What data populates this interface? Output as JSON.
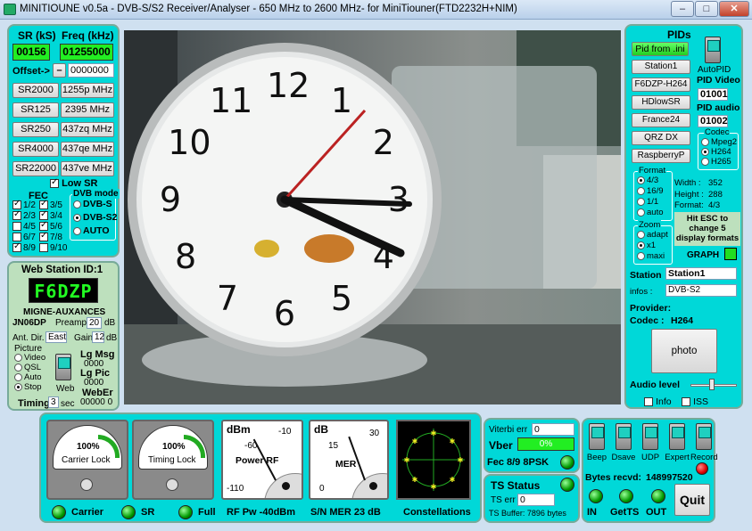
{
  "window": {
    "title": "MINITIOUNE v0.5a - DVB-S/S2 Receiver/Analyser - 650 MHz to 2600 MHz- for MiniTiouner(FTD2232H+NIM)",
    "min": "–",
    "max": "□",
    "close": "✕"
  },
  "left": {
    "sr_label": "SR (kS)",
    "freq_label": "Freq (kHz)",
    "sr_value": "00156",
    "freq_value": "01255000",
    "offset_label": "Offset->",
    "offset_sign": "–",
    "offset_value": "0000000",
    "sr_buttons": [
      "SR2000",
      "SR125",
      "SR250",
      "SR4000",
      "SR22000"
    ],
    "freq_buttons": [
      "1255p MHz",
      "2395 MHz",
      "437zq MHz",
      "437qe MHz",
      "437ve MHz"
    ],
    "low_sr": "Low SR",
    "fec_title": "FEC",
    "fec": [
      "1/2",
      "2/3",
      "4/5",
      "6/7",
      "8/9",
      "3/5",
      "3/4",
      "5/6",
      "7/8",
      "9/10"
    ],
    "dvb_title": "DVB mode",
    "dvb": [
      "DVB-S",
      "DVB-S2",
      "AUTO"
    ]
  },
  "station": {
    "title": "Web Station ID:1",
    "callsign": "F6DZP",
    "name": "MIGNE-AUXANCES",
    "locator": "JN06DP",
    "preamp_label": "Preamp",
    "preamp_value": "20",
    "preamp_unit": "dB",
    "antdir_label": "Ant. Dir.",
    "antdir_value": "East",
    "gain_label": "Gain",
    "gain_value": "12",
    "gain_unit": "dB",
    "picture_label": "Picture",
    "picture_opts": [
      "Video",
      "QSL",
      "Auto",
      "Stop"
    ],
    "lgmsg_label": "Lg Msg",
    "lgmsg_value": "0000",
    "lgpic_label": "Lg Pic",
    "lgpic_value": "0000",
    "web_label": "Web",
    "weber_label": "WebEr",
    "weber_value": "00000 0",
    "timing_label": "Timing",
    "timing_value": "3",
    "timing_unit": "sec"
  },
  "right": {
    "pids_title": "PIDs",
    "pid_from_ini": "Pid from .ini",
    "stations": [
      "Station1",
      "F6DZP-H264",
      "HDlowSR",
      "France24",
      "QRZ DX",
      "RaspberryP"
    ],
    "autopid": "AutoPID",
    "pid_video_label": "PID Video",
    "pid_video": "01001",
    "pid_audio_label": "PID audio",
    "pid_audio": "01002",
    "codec_title": "Codec",
    "codecs": [
      "Mpeg2",
      "H264",
      "H265"
    ],
    "format_title": "Format",
    "formats": [
      "4/3",
      "16/9",
      "1/1",
      "auto"
    ],
    "width_label": "Width :",
    "width_value": "352",
    "height_label": "Height :",
    "height_value": "288",
    "format_label": "Format:",
    "format_value": "4/3",
    "esc_text": "Hit ESC to change 5 display formats",
    "zoom_title": "Zoom",
    "zooms": [
      "adapt",
      "x1",
      "maxi"
    ],
    "graph": "GRAPH",
    "station_label": "Station",
    "station_value": "Station1",
    "infos_label": "infos :",
    "infos_value": "DVB-S2",
    "provider_label": "Provider:",
    "codec_label": "Codec :",
    "codec_value": "H264",
    "photo": "photo",
    "audio_label": "Audio level",
    "info_label": "Info",
    "iss_label": "ISS"
  },
  "video": {
    "clock_numbers": [
      "12",
      "1",
      "2",
      "3",
      "4",
      "5",
      "6",
      "7",
      "8",
      "9",
      "10",
      "11"
    ]
  },
  "bottom": {
    "carrier_pct": "100%",
    "carrier_label": "Carrier Lock",
    "timing_pct": "100%",
    "timing_label": "Timing Lock",
    "power_unit": "dBm",
    "power_ticks": [
      "-60",
      "-10",
      "-110"
    ],
    "power_title": "Power RF",
    "mer_unit": "dB",
    "mer_ticks": [
      "15",
      "30",
      "0"
    ],
    "mer_title": "MER",
    "viterbi_label": "Viterbi err",
    "viterbi_value": "0",
    "vber_label": "Vber",
    "vber_value": "0%",
    "fec_status": "Fec 8/9 8PSK",
    "ts_status": "TS Status",
    "ts_err_label": "TS err",
    "ts_err_value": "0",
    "ts_buffer": "TS Buffer: 7896 bytes",
    "switches": [
      "Beep",
      "Dsave",
      "UDP",
      "Expert",
      "Record"
    ],
    "bytes_label": "Bytes recvd:",
    "bytes_value": "148997520",
    "quit": "Quit",
    "in_label": "IN",
    "getts_label": "GetTS",
    "out_label": "OUT",
    "status_carrier": "Carrier",
    "status_sr": "SR",
    "status_full": "Full",
    "rfpw": "RF Pw  -40dBm",
    "snmer": "S/N MER   23 dB",
    "constellations": "Constellations"
  },
  "colors": {
    "panel": "#00d8d8",
    "lcd": "#22ee22",
    "station_panel": "#bde0bd"
  }
}
